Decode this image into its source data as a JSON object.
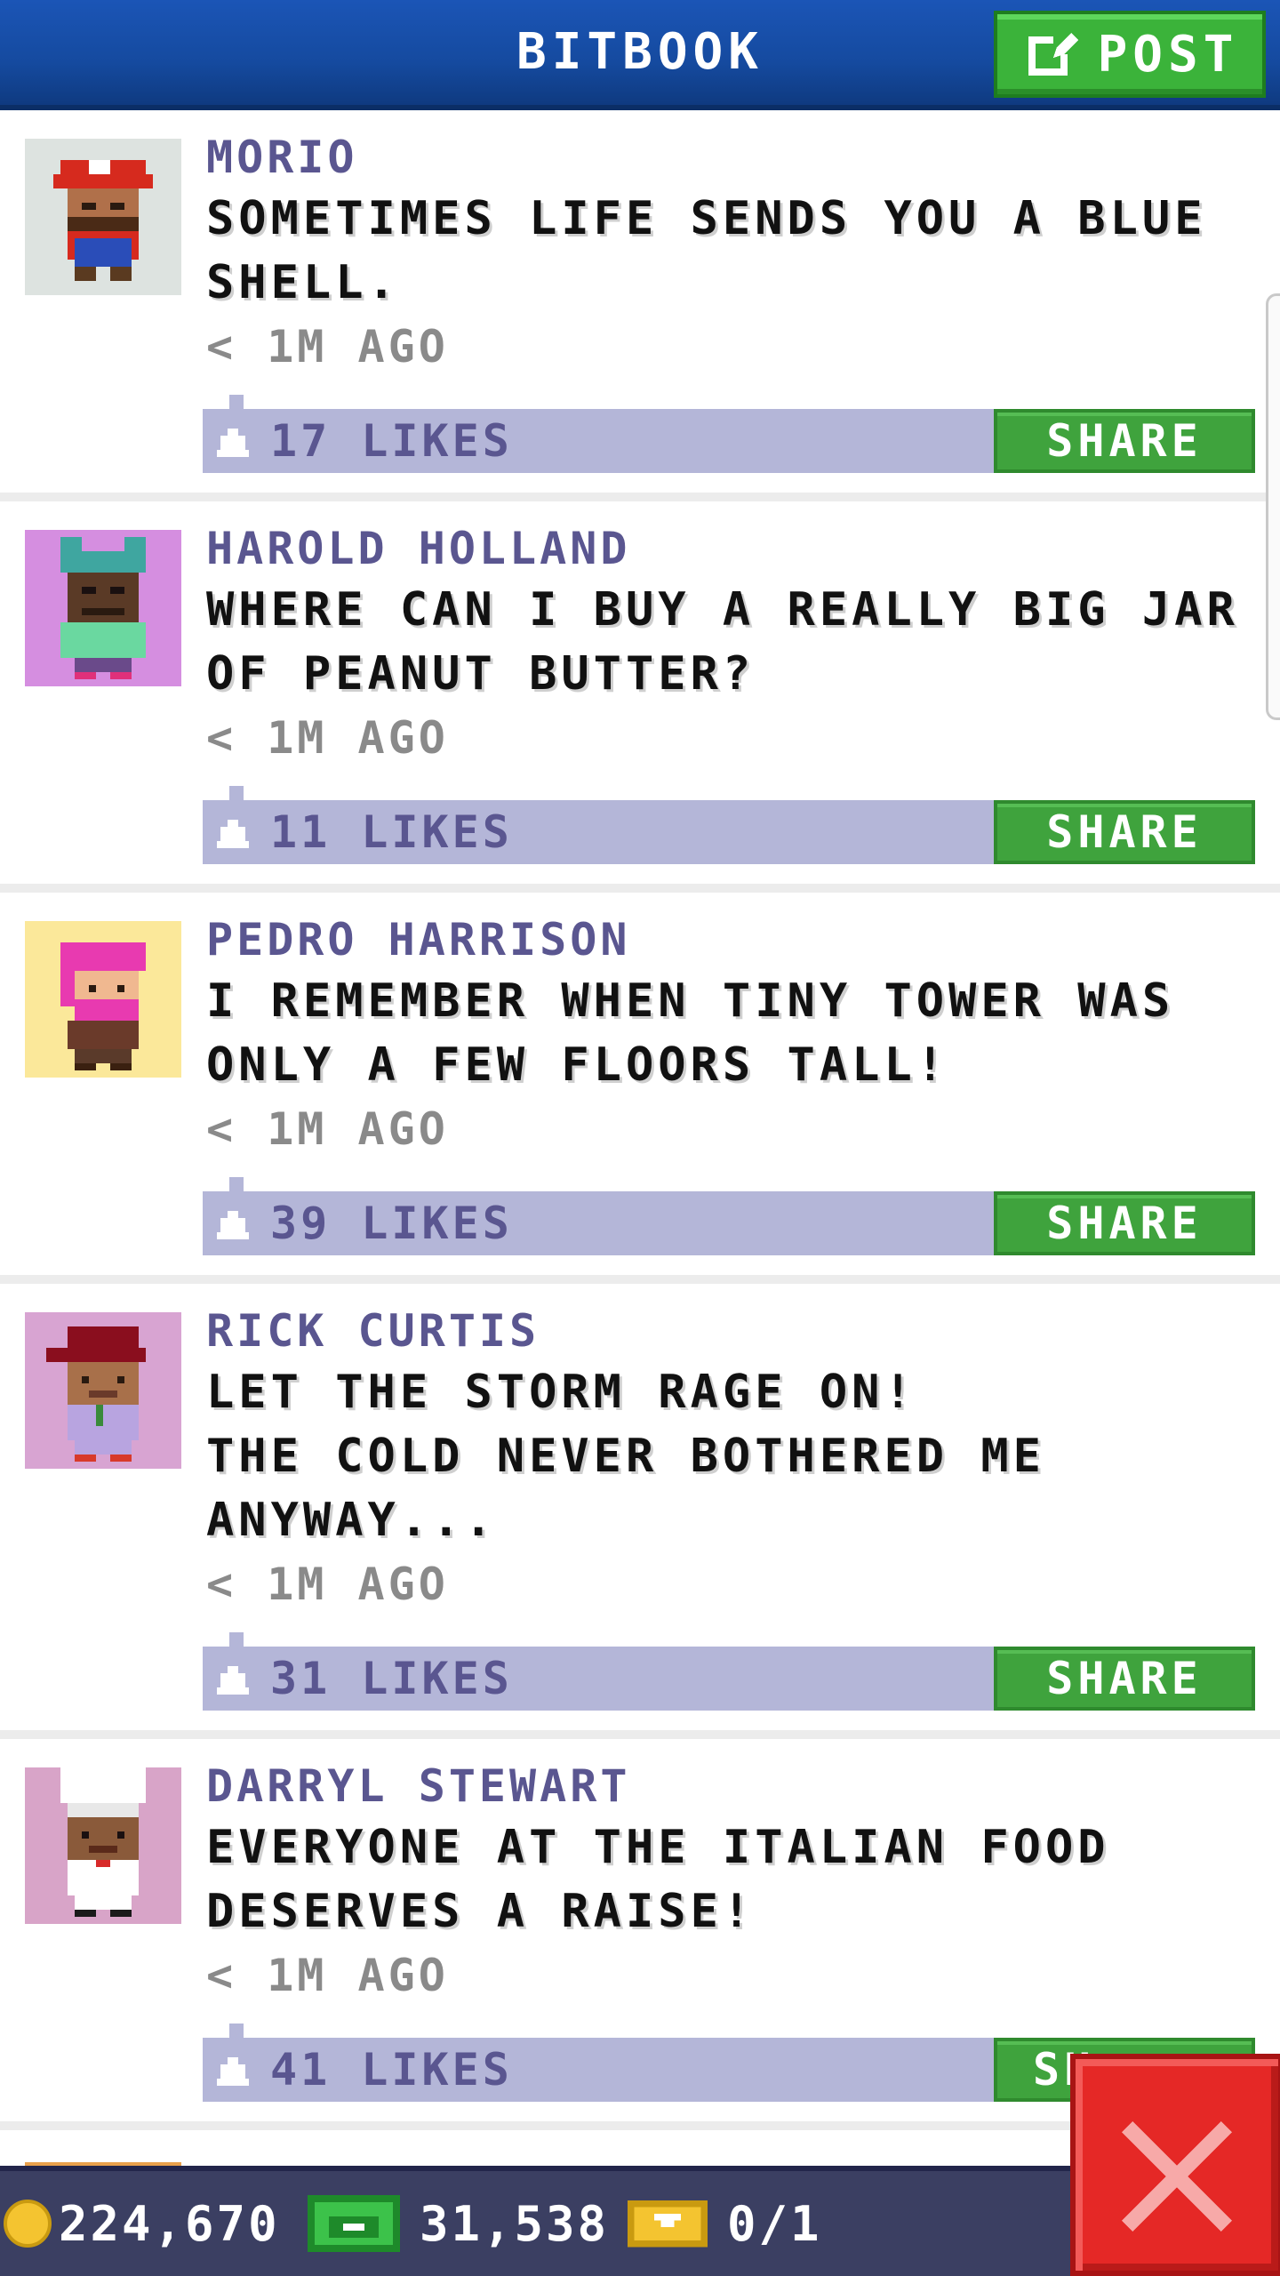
{
  "header": {
    "title": "BITBOOK",
    "post_label": "POST",
    "colors": {
      "bar": "#1b55b6",
      "post_button": "#3bb33a"
    }
  },
  "feed": {
    "posts": [
      {
        "author": "MORIO",
        "message": "SOMETIMES LIFE SENDS YOU A BLUE\nSHELL.",
        "time": "< 1M AGO",
        "likes": "17 LIKES",
        "share_label": "SHARE",
        "avatar_icon": "plumber-avatar-icon",
        "avatar_bg": "#dde3e0"
      },
      {
        "author": "HAROLD HOLLAND",
        "message": "WHERE CAN I BUY A REALLY BIG JAR\nOF PEANUT BUTTER?",
        "time": "< 1M AGO",
        "likes": "11 LIKES",
        "share_label": "SHARE",
        "avatar_icon": "frog-hat-avatar-icon",
        "avatar_bg": "#d58ee0"
      },
      {
        "author": "PEDRO HARRISON",
        "message": "I REMEMBER WHEN TINY TOWER WAS\nONLY A FEW FLOORS TALL!",
        "time": "< 1M AGO",
        "likes": "39 LIKES",
        "share_label": "SHARE",
        "avatar_icon": "pink-hair-avatar-icon",
        "avatar_bg": "#fbe89a"
      },
      {
        "author": "RICK CURTIS",
        "message": "LET THE STORM RAGE ON!\nTHE COLD NEVER BOTHERED ME\nANYWAY...",
        "time": "< 1M AGO",
        "likes": "31 LIKES",
        "share_label": "SHARE",
        "avatar_icon": "red-cap-avatar-icon",
        "avatar_bg": "#d8a4d2"
      },
      {
        "author": "DARRYL STEWART",
        "message": "EVERYONE AT THE ITALIAN FOOD\nDESERVES A RAISE!",
        "time": "< 1M AGO",
        "likes": "41 LIKES",
        "share_label": "SH",
        "avatar_icon": "chef-avatar-icon",
        "avatar_bg": "#d8a4c8"
      }
    ]
  },
  "status": {
    "coins": "224,670",
    "bux": "31,538",
    "tickets": "0/1"
  },
  "close_icon": "close-x-icon"
}
